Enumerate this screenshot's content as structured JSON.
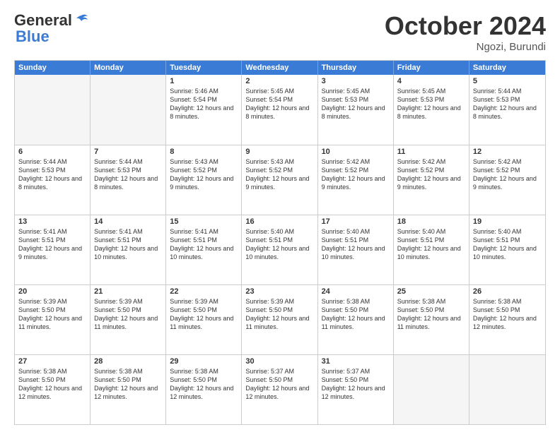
{
  "logo": {
    "part1": "General",
    "part2": "Blue"
  },
  "title": "October 2024",
  "location": "Ngozi, Burundi",
  "days_of_week": [
    "Sunday",
    "Monday",
    "Tuesday",
    "Wednesday",
    "Thursday",
    "Friday",
    "Saturday"
  ],
  "weeks": [
    [
      {
        "day": "",
        "empty": true
      },
      {
        "day": "",
        "empty": true
      },
      {
        "day": "1",
        "sunrise": "5:46 AM",
        "sunset": "5:54 PM",
        "daylight": "12 hours and 8 minutes."
      },
      {
        "day": "2",
        "sunrise": "5:45 AM",
        "sunset": "5:54 PM",
        "daylight": "12 hours and 8 minutes."
      },
      {
        "day": "3",
        "sunrise": "5:45 AM",
        "sunset": "5:53 PM",
        "daylight": "12 hours and 8 minutes."
      },
      {
        "day": "4",
        "sunrise": "5:45 AM",
        "sunset": "5:53 PM",
        "daylight": "12 hours and 8 minutes."
      },
      {
        "day": "5",
        "sunrise": "5:44 AM",
        "sunset": "5:53 PM",
        "daylight": "12 hours and 8 minutes."
      }
    ],
    [
      {
        "day": "6",
        "sunrise": "5:44 AM",
        "sunset": "5:53 PM",
        "daylight": "12 hours and 8 minutes."
      },
      {
        "day": "7",
        "sunrise": "5:44 AM",
        "sunset": "5:53 PM",
        "daylight": "12 hours and 8 minutes."
      },
      {
        "day": "8",
        "sunrise": "5:43 AM",
        "sunset": "5:52 PM",
        "daylight": "12 hours and 9 minutes."
      },
      {
        "day": "9",
        "sunrise": "5:43 AM",
        "sunset": "5:52 PM",
        "daylight": "12 hours and 9 minutes."
      },
      {
        "day": "10",
        "sunrise": "5:42 AM",
        "sunset": "5:52 PM",
        "daylight": "12 hours and 9 minutes."
      },
      {
        "day": "11",
        "sunrise": "5:42 AM",
        "sunset": "5:52 PM",
        "daylight": "12 hours and 9 minutes."
      },
      {
        "day": "12",
        "sunrise": "5:42 AM",
        "sunset": "5:52 PM",
        "daylight": "12 hours and 9 minutes."
      }
    ],
    [
      {
        "day": "13",
        "sunrise": "5:41 AM",
        "sunset": "5:51 PM",
        "daylight": "12 hours and 9 minutes."
      },
      {
        "day": "14",
        "sunrise": "5:41 AM",
        "sunset": "5:51 PM",
        "daylight": "12 hours and 10 minutes."
      },
      {
        "day": "15",
        "sunrise": "5:41 AM",
        "sunset": "5:51 PM",
        "daylight": "12 hours and 10 minutes."
      },
      {
        "day": "16",
        "sunrise": "5:40 AM",
        "sunset": "5:51 PM",
        "daylight": "12 hours and 10 minutes."
      },
      {
        "day": "17",
        "sunrise": "5:40 AM",
        "sunset": "5:51 PM",
        "daylight": "12 hours and 10 minutes."
      },
      {
        "day": "18",
        "sunrise": "5:40 AM",
        "sunset": "5:51 PM",
        "daylight": "12 hours and 10 minutes."
      },
      {
        "day": "19",
        "sunrise": "5:40 AM",
        "sunset": "5:51 PM",
        "daylight": "12 hours and 10 minutes."
      }
    ],
    [
      {
        "day": "20",
        "sunrise": "5:39 AM",
        "sunset": "5:50 PM",
        "daylight": "12 hours and 11 minutes."
      },
      {
        "day": "21",
        "sunrise": "5:39 AM",
        "sunset": "5:50 PM",
        "daylight": "12 hours and 11 minutes."
      },
      {
        "day": "22",
        "sunrise": "5:39 AM",
        "sunset": "5:50 PM",
        "daylight": "12 hours and 11 minutes."
      },
      {
        "day": "23",
        "sunrise": "5:39 AM",
        "sunset": "5:50 PM",
        "daylight": "12 hours and 11 minutes."
      },
      {
        "day": "24",
        "sunrise": "5:38 AM",
        "sunset": "5:50 PM",
        "daylight": "12 hours and 11 minutes."
      },
      {
        "day": "25",
        "sunrise": "5:38 AM",
        "sunset": "5:50 PM",
        "daylight": "12 hours and 11 minutes."
      },
      {
        "day": "26",
        "sunrise": "5:38 AM",
        "sunset": "5:50 PM",
        "daylight": "12 hours and 12 minutes."
      }
    ],
    [
      {
        "day": "27",
        "sunrise": "5:38 AM",
        "sunset": "5:50 PM",
        "daylight": "12 hours and 12 minutes."
      },
      {
        "day": "28",
        "sunrise": "5:38 AM",
        "sunset": "5:50 PM",
        "daylight": "12 hours and 12 minutes."
      },
      {
        "day": "29",
        "sunrise": "5:38 AM",
        "sunset": "5:50 PM",
        "daylight": "12 hours and 12 minutes."
      },
      {
        "day": "30",
        "sunrise": "5:37 AM",
        "sunset": "5:50 PM",
        "daylight": "12 hours and 12 minutes."
      },
      {
        "day": "31",
        "sunrise": "5:37 AM",
        "sunset": "5:50 PM",
        "daylight": "12 hours and 12 minutes."
      },
      {
        "day": "",
        "empty": true
      },
      {
        "day": "",
        "empty": true
      }
    ]
  ]
}
